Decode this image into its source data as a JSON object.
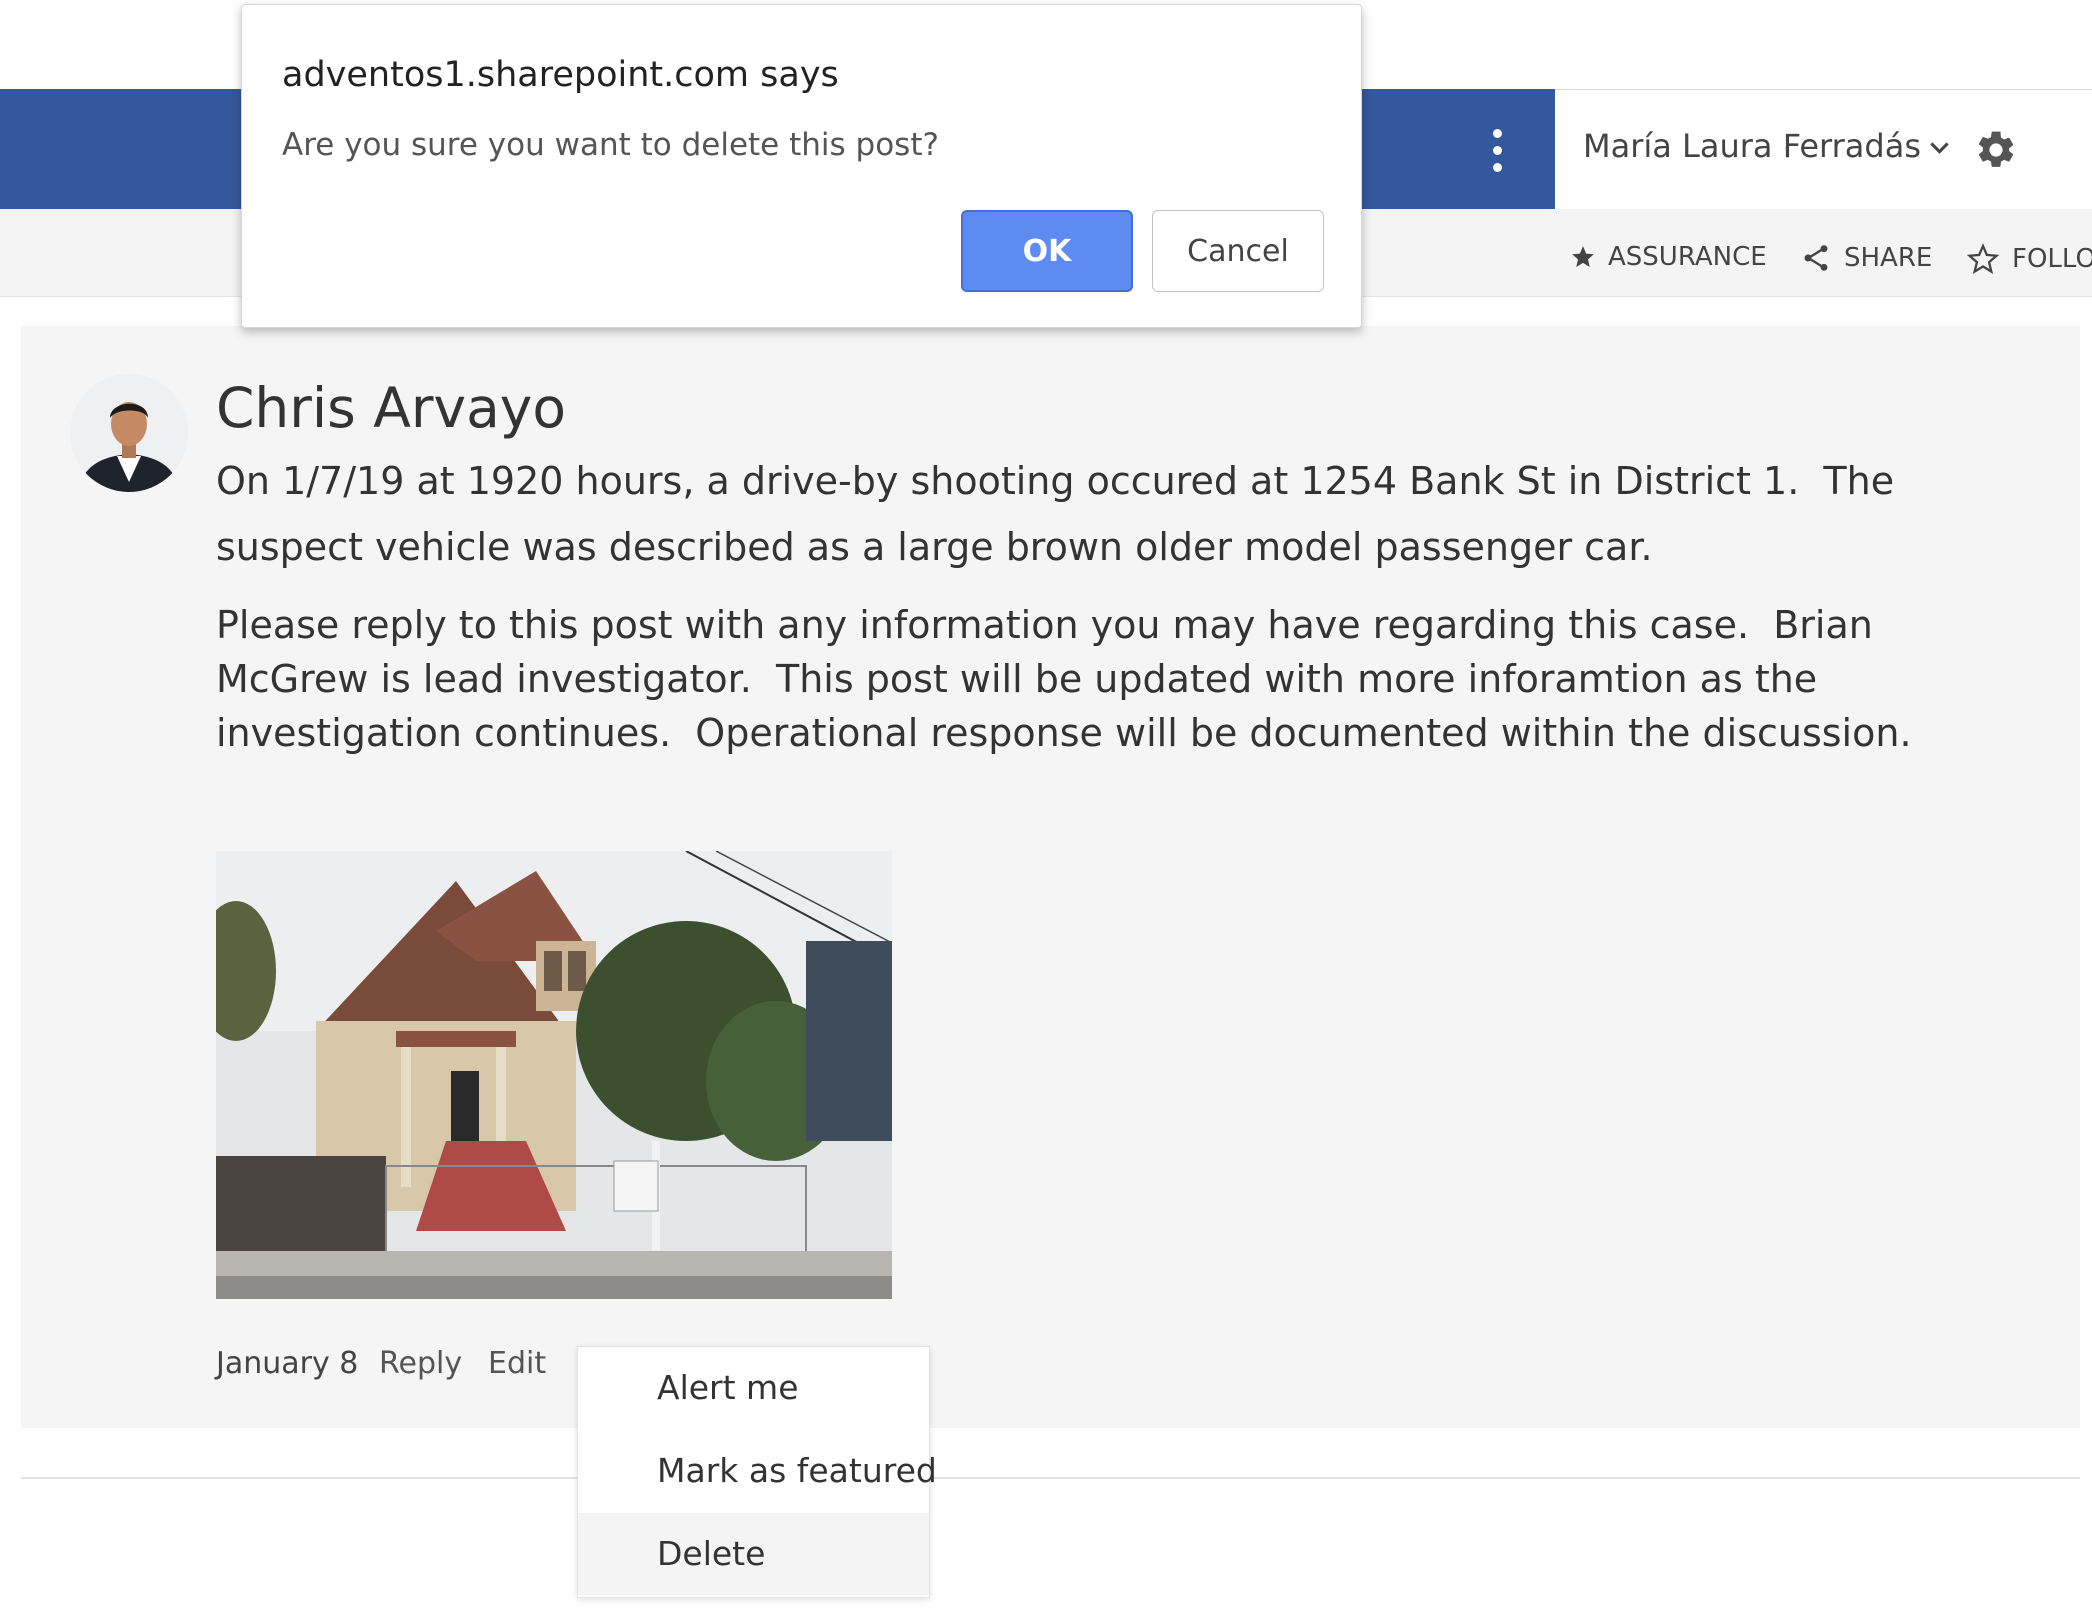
{
  "colors": {
    "suite_bar": "#34589c",
    "ok_button": "#5d8bf1"
  },
  "header": {
    "user_name": "María Laura Ferradás",
    "more_icon": "more-vertical-icon",
    "settings_icon": "gear-icon"
  },
  "commands": [
    {
      "label": "ASSURANCE",
      "icon": "star-filled-icon"
    },
    {
      "label": "SHARE",
      "icon": "share-icon"
    },
    {
      "label": "FOLLO",
      "icon": "star-outline-icon"
    }
  ],
  "dialog": {
    "title": "adventos1.sharepoint.com says",
    "message": "Are you sure you want to delete this post?",
    "ok_label": "OK",
    "cancel_label": "Cancel"
  },
  "post": {
    "author": "Chris Arvayo",
    "paragraph1": "On 1/7/19 at 1920 hours, a drive-by shooting occured at 1254 Bank St in District 1.  The suspect vehicle was described as a large brown older model passenger car.",
    "paragraph2": "Please reply to this post with any information you may have regarding this case.  Brian McGrew is lead investigator.  This post will be updated with more inforamtion as the investigation continues.  Operational response will be documented within the discussion.",
    "date": "January 8",
    "reply_label": "Reply",
    "edit_label": "Edit"
  },
  "context_menu": {
    "items": [
      {
        "label": "Alert me"
      },
      {
        "label": "Mark as featured"
      },
      {
        "label": "Delete"
      }
    ]
  }
}
